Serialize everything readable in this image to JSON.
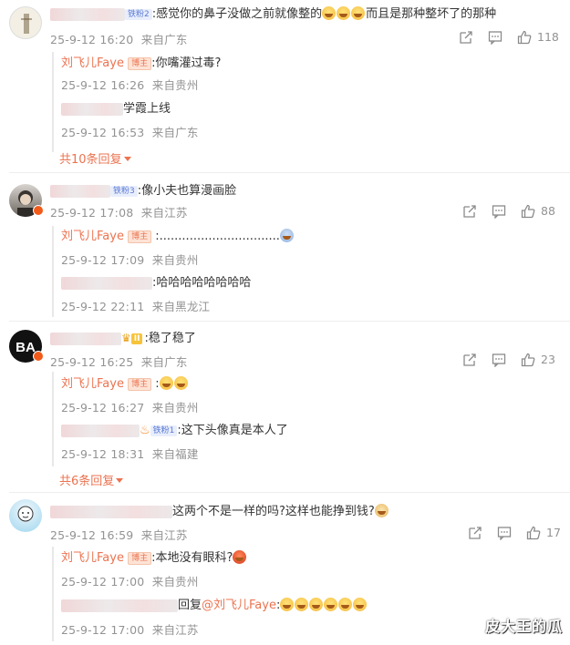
{
  "comments": [
    {
      "text_prefix": ":",
      "text": "感觉你的鼻子没做之前就像整的",
      "text_suffix": "而且是那种整坏了的那种",
      "fan_badge": "铁粉2",
      "time": "25-9-12 16:20",
      "location": "来自广东",
      "likes": "118",
      "replies": [
        {
          "author": "刘飞儿Faye",
          "badge": "博主",
          "text": ":你嘴灌过毒?",
          "time": "25-9-12 16:26",
          "location": "来自贵州"
        },
        {
          "author_suffix": "学霞上线",
          "text": "",
          "time": "25-9-12 16:53",
          "location": "来自广东"
        }
      ],
      "more": "共10条回复"
    },
    {
      "fan_badge": "铁粉3",
      "text": ":像小夫也算漫画脸",
      "time": "25-9-12 17:08",
      "location": "来自江苏",
      "likes": "88",
      "replies": [
        {
          "author": "刘飞儿Faye",
          "badge": "博主",
          "text": ":................................",
          "time": "25-9-12 17:09",
          "location": "来自贵州"
        },
        {
          "text": ":哈哈哈哈哈哈哈哈",
          "time": "25-9-12 22:11",
          "location": "来自黑龙江"
        }
      ]
    },
    {
      "avatar_text": "BA",
      "level_badge": "II",
      "text": ":稳了稳了",
      "time": "25-9-12 16:25",
      "location": "来自广东",
      "likes": "23",
      "replies": [
        {
          "author": "刘飞儿Faye",
          "badge": "博主",
          "text": ":",
          "time": "25-9-12 16:27",
          "location": "来自贵州"
        },
        {
          "fan_badge": "铁粉1",
          "text": ":这下头像真是本人了",
          "time": "25-9-12 18:31",
          "location": "来自福建"
        }
      ],
      "more": "共6条回复"
    },
    {
      "text": "这两个不是一样的吗?这样也能挣到钱?",
      "time": "25-9-12 16:59",
      "location": "来自江苏",
      "likes": "17",
      "replies": [
        {
          "author": "刘飞儿Faye",
          "badge": "博主",
          "text": ":本地没有眼科?",
          "time": "25-9-12 17:00",
          "location": "来自贵州"
        },
        {
          "reply_prefix": "回复",
          "mention": "@刘飞儿Faye",
          "text": ":",
          "time": "25-9-12 17:00",
          "location": "来自江苏"
        }
      ]
    }
  ],
  "watermark": "皮大王的瓜",
  "colors": {
    "accent": "#eb7350",
    "meta": "#939393",
    "mention": "#eb7350"
  },
  "icons": [
    "share-icon",
    "comment-icon",
    "like-icon"
  ]
}
